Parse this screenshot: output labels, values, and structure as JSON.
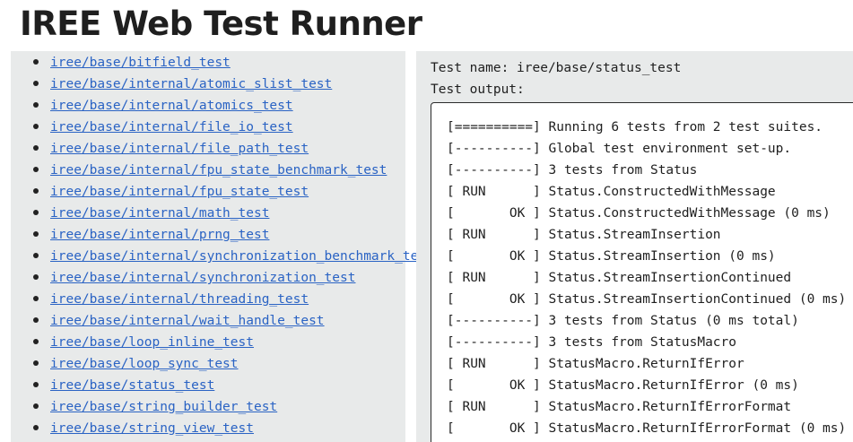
{
  "page": {
    "title": "IREE Web Test Runner"
  },
  "tests": [
    "iree/base/bitfield_test",
    "iree/base/internal/atomic_slist_test",
    "iree/base/internal/atomics_test",
    "iree/base/internal/file_io_test",
    "iree/base/internal/file_path_test",
    "iree/base/internal/fpu_state_benchmark_test",
    "iree/base/internal/fpu_state_test",
    "iree/base/internal/math_test",
    "iree/base/internal/prng_test",
    "iree/base/internal/synchronization_benchmark_test",
    "iree/base/internal/synchronization_test",
    "iree/base/internal/threading_test",
    "iree/base/internal/wait_handle_test",
    "iree/base/loop_inline_test",
    "iree/base/loop_sync_test",
    "iree/base/status_test",
    "iree/base/string_builder_test",
    "iree/base/string_view_test"
  ],
  "result": {
    "name_line": "Test name: iree/base/status_test",
    "output_label": "Test output:",
    "output_lines": [
      "[==========] Running 6 tests from 2 test suites.",
      "[----------] Global test environment set-up.",
      "[----------] 3 tests from Status",
      "[ RUN      ] Status.ConstructedWithMessage",
      "[       OK ] Status.ConstructedWithMessage (0 ms)",
      "[ RUN      ] Status.StreamInsertion",
      "[       OK ] Status.StreamInsertion (0 ms)",
      "[ RUN      ] Status.StreamInsertionContinued",
      "[       OK ] Status.StreamInsertionContinued (0 ms)",
      "[----------] 3 tests from Status (0 ms total)",
      "[----------] 3 tests from StatusMacro",
      "[ RUN      ] StatusMacro.ReturnIfError",
      "[       OK ] StatusMacro.ReturnIfError (0 ms)",
      "[ RUN      ] StatusMacro.ReturnIfErrorFormat",
      "[       OK ] StatusMacro.ReturnIfErrorFormat (0 ms)"
    ]
  },
  "colors": {
    "link": "#2a63c4",
    "panel": "#e8eaea",
    "text": "#1f1f1f"
  }
}
